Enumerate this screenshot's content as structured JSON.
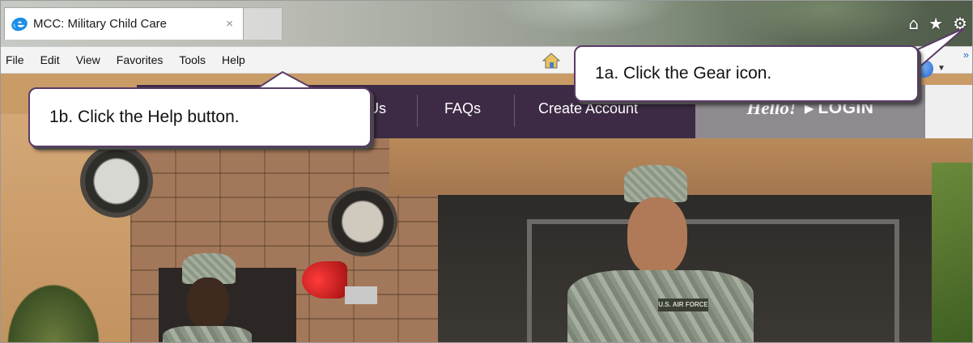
{
  "browser": {
    "tab_title": "MCC: Military Child Care",
    "tab_close": "×",
    "right_icons": [
      "home-icon",
      "star-icon",
      "gear-icon"
    ],
    "right_icon_glyphs": [
      "⌂",
      "★",
      "⚙"
    ],
    "chevrons": "»"
  },
  "menubar": {
    "items": [
      "File",
      "Edit",
      "View",
      "Favorites",
      "Tools",
      "Help"
    ]
  },
  "site_nav": {
    "partial_item": "Us",
    "faqs": "FAQs",
    "create_account": "Create Account",
    "hello": "Hello!",
    "login_arrow": "▶",
    "login": "LOGIN"
  },
  "hero": {
    "patch_text": "U.S. AIR FORCE"
  },
  "callouts": {
    "help": "1b. Click the Help button.",
    "gear": "1a. Click the Gear icon."
  },
  "colors": {
    "nav_bg": "#3d2b45",
    "login_bg": "#8f8a8f",
    "callout_border": "#5a3b66",
    "ie_blue": "#1b8ee6"
  }
}
